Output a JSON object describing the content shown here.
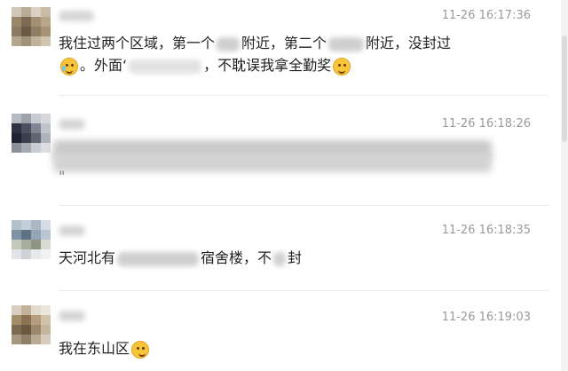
{
  "comments": [
    {
      "timestamp": "11-26 16:17:36",
      "line1": [
        "我住过两个区域，第一个",
        "附近，第二个",
        "附近，没封过"
      ],
      "line2": [
        "。外面‘",
        "，不耽误我拿全勤奖"
      ],
      "emoji_before": "crying-laughing-emoji",
      "emoji_after": "grinning-sweat-emoji"
    },
    {
      "timestamp": "11-26 16:18:26",
      "tail_text": "\"",
      "note": "text blurred"
    },
    {
      "timestamp": "11-26 16:18:35",
      "parts": [
        "天河北有",
        "宿舍楼，不",
        "封"
      ]
    },
    {
      "timestamp": "11-26 16:19:03",
      "text": "我在东山区",
      "emoji": "smirk-emoji"
    }
  ],
  "colors": {
    "timestamp": "#9a9a9a",
    "text": "#222222",
    "divider": "#ececec"
  }
}
